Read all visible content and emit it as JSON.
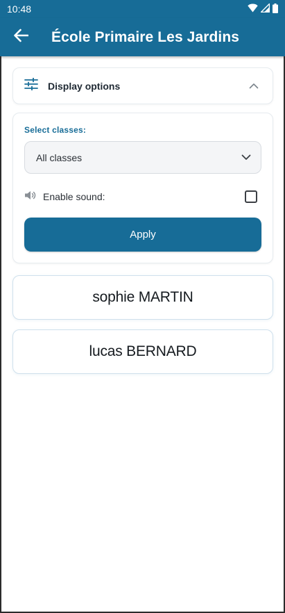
{
  "status_bar": {
    "time": "10:48",
    "icons": [
      "wifi-icon",
      "signal-icon",
      "battery-icon"
    ]
  },
  "app_bar": {
    "back_icon": "arrow-left-icon",
    "title": "École Primaire Les Jardins"
  },
  "display_options": {
    "icon": "sliders-icon",
    "label": "Display options",
    "expanded": true
  },
  "filters": {
    "select_label": "Select classes:",
    "selected_class": "All classes",
    "sound_label": "Enable sound:",
    "sound_enabled": false,
    "apply_label": "Apply"
  },
  "students": [
    {
      "name": "sophie MARTIN"
    },
    {
      "name": "lucas BERNARD"
    }
  ],
  "colors": {
    "primary": "#176c97",
    "background": "#ffffff",
    "card_border": "#cfe0ec"
  }
}
